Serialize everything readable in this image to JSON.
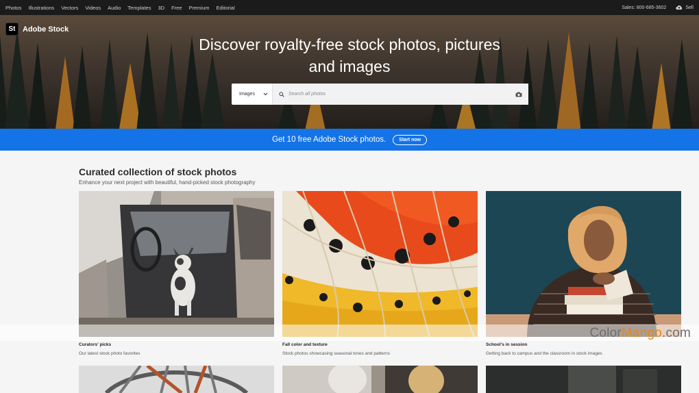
{
  "topnav": {
    "links": [
      "Photos",
      "Illustrations",
      "Vectors",
      "Videos",
      "Audio",
      "Templates",
      "3D",
      "Free",
      "Premium",
      "Editorial"
    ],
    "sales": "Sales: 800-685-3602",
    "sell": "Sell"
  },
  "brand": {
    "logo_mark": "St",
    "name": "Adobe Stock"
  },
  "hero": {
    "title_line1": "Discover royalty-free stock photos, pictures",
    "title_line2": "and images"
  },
  "search": {
    "category": "Images",
    "placeholder": "Search all photos"
  },
  "promo": {
    "text": "Get 10 free Adobe Stock photos.",
    "button": "Start now"
  },
  "section": {
    "title": "Curated collection of stock photos",
    "subtitle": "Enhance your next project with beautiful, hand-picked stock photography"
  },
  "cards": [
    {
      "title": "Curators' picks",
      "desc": "Our latest stock photo favorites"
    },
    {
      "title": "Fall color and texture",
      "desc": "Stock photos showcasing seasonal tones and patterns"
    },
    {
      "title": "School's in session",
      "desc": "Getting back to campus and the classroom in stock images"
    }
  ],
  "watermark": {
    "part1": "Color",
    "part2": "Mango",
    "part3": ".com"
  },
  "colors": {
    "promo_blue": "#1473e6",
    "nav_bg": "#1b1b1b",
    "watermark_orange": "#e0891f"
  },
  "icons": [
    "search-icon",
    "camera-icon",
    "chevron-down-icon",
    "cloud-upload-icon"
  ]
}
